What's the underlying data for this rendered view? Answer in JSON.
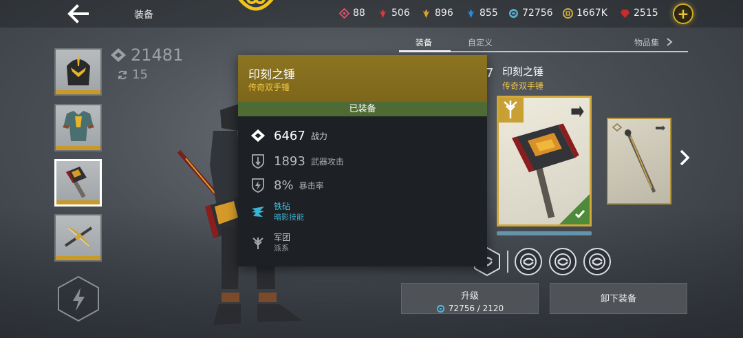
{
  "header": {
    "title": "装备",
    "resources": [
      {
        "icon": "pink-gem-icon",
        "value": "88",
        "color": "#e0506e"
      },
      {
        "icon": "red-crystal-icon",
        "value": "506",
        "color": "#d43b3b"
      },
      {
        "icon": "gold-crystal-icon",
        "value": "896",
        "color": "#d9a02a"
      },
      {
        "icon": "blue-crystal-icon",
        "value": "855",
        "color": "#2e8ad4"
      },
      {
        "icon": "swirl-currency-icon",
        "value": "72756",
        "color": "#5fa9c9"
      },
      {
        "icon": "gold-coin-icon",
        "value": "1667K",
        "color": "#d7b440"
      },
      {
        "icon": "ruby-icon",
        "value": "2515",
        "color": "#c92a2a"
      }
    ]
  },
  "tabs": {
    "equipment": "装备",
    "custom": "自定义",
    "collection": "物品集"
  },
  "left": {
    "total_power": "21481",
    "level": "15"
  },
  "tooltip": {
    "name": "印刻之锤",
    "type": "传奇双手锤",
    "status": "已装备",
    "power_value": "6467",
    "power_label": "战力",
    "attack_value": "1893",
    "attack_label": "武器攻击",
    "crit_value": "8%",
    "crit_label": "暴击率",
    "skill_name": "铁砧",
    "skill_type": "暗影技能",
    "faction_name": "军团",
    "faction_label": "派系"
  },
  "right": {
    "item_name": "印刻之锤",
    "item_type": "传奇双手锤",
    "power_ghost": "6467",
    "power_tail": "7"
  },
  "buttons": {
    "upgrade": "升级",
    "upgrade_cost": "72756 / 2120",
    "unequip": "卸下装备"
  },
  "colors": {
    "legendary_gold": "#f3c842",
    "equipped_green": "#4e6a35",
    "tooltip_header": "#8c7421"
  }
}
